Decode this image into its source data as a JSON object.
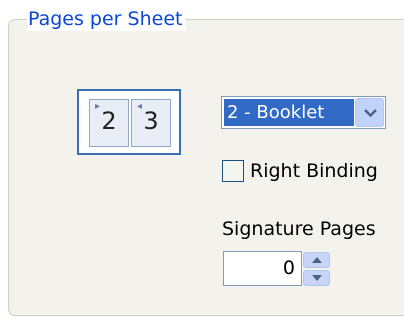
{
  "group": {
    "title": "Pages per Sheet"
  },
  "preview": {
    "left_page": "2",
    "right_page": "3"
  },
  "pages_per_sheet": {
    "selected": "2 - Booklet"
  },
  "right_binding": {
    "label": "Right Binding",
    "checked": false
  },
  "signature_pages": {
    "label": "Signature Pages",
    "value": "0"
  },
  "colors": {
    "legend_text": "#0a46d5",
    "selection": "#316ac5",
    "panel": "#f3f2ec"
  }
}
